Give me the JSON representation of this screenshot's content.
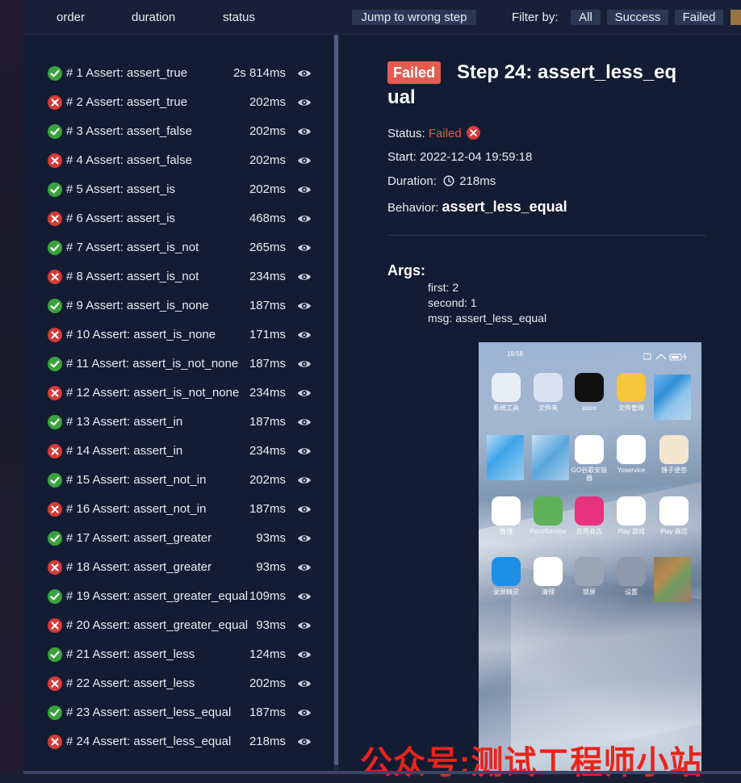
{
  "header": {
    "order": "order",
    "duration": "duration",
    "status": "status",
    "jump_button": "Jump to wrong step",
    "filter_label": "Filter by:",
    "filter_all": "All",
    "filter_success": "Success",
    "filter_failed": "Failed"
  },
  "steps": [
    {
      "name": "# 1 Assert: assert_true",
      "duration": "2s 814ms",
      "status": "success"
    },
    {
      "name": "# 2 Assert: assert_true",
      "duration": "202ms",
      "status": "failed"
    },
    {
      "name": "# 3 Assert: assert_false",
      "duration": "202ms",
      "status": "success"
    },
    {
      "name": "# 4 Assert: assert_false",
      "duration": "202ms",
      "status": "failed"
    },
    {
      "name": "# 5 Assert: assert_is",
      "duration": "202ms",
      "status": "success"
    },
    {
      "name": "# 6 Assert: assert_is",
      "duration": "468ms",
      "status": "failed"
    },
    {
      "name": "# 7 Assert: assert_is_not",
      "duration": "265ms",
      "status": "success"
    },
    {
      "name": "# 8 Assert: assert_is_not",
      "duration": "234ms",
      "status": "failed"
    },
    {
      "name": "# 9 Assert: assert_is_none",
      "duration": "187ms",
      "status": "success"
    },
    {
      "name": "# 10 Assert: assert_is_none",
      "duration": "171ms",
      "status": "failed"
    },
    {
      "name": "# 11 Assert: assert_is_not_none",
      "duration": "187ms",
      "status": "success"
    },
    {
      "name": "# 12 Assert: assert_is_not_none",
      "duration": "234ms",
      "status": "failed"
    },
    {
      "name": "# 13 Assert: assert_in",
      "duration": "187ms",
      "status": "success"
    },
    {
      "name": "# 14 Assert: assert_in",
      "duration": "234ms",
      "status": "failed"
    },
    {
      "name": "# 15 Assert: assert_not_in",
      "duration": "202ms",
      "status": "success"
    },
    {
      "name": "# 16 Assert: assert_not_in",
      "duration": "187ms",
      "status": "failed"
    },
    {
      "name": "# 17 Assert: assert_greater",
      "duration": "93ms",
      "status": "success"
    },
    {
      "name": "# 18 Assert: assert_greater",
      "duration": "93ms",
      "status": "failed"
    },
    {
      "name": "# 19 Assert: assert_greater_equal",
      "duration": "109ms",
      "status": "success"
    },
    {
      "name": "# 20 Assert: assert_greater_equal",
      "duration": "93ms",
      "status": "failed"
    },
    {
      "name": "# 21 Assert: assert_less",
      "duration": "124ms",
      "status": "success"
    },
    {
      "name": "# 22 Assert: assert_less",
      "duration": "202ms",
      "status": "failed"
    },
    {
      "name": "# 23 Assert: assert_less_equal",
      "duration": "187ms",
      "status": "success"
    },
    {
      "name": "# 24 Assert: assert_less_equal",
      "duration": "218ms",
      "status": "failed"
    }
  ],
  "detail": {
    "badge": "Failed",
    "title": "Step 24: assert_less_equal",
    "status_label": "Status:",
    "status_value": "Failed",
    "start_label": "Start:",
    "start_value": "2022-12-04 19:59:18",
    "duration_label": "Duration:",
    "duration_value": "218ms",
    "behavior_label": "Behavior:",
    "behavior_value": "assert_less_equal",
    "args_heading": "Args:",
    "args": [
      "first: 2",
      "second: 1",
      "msg: assert_less_equal"
    ]
  },
  "phone": {
    "status_time": "19:58",
    "apps": [
      {
        "label": "系统工具",
        "color": "#e9eef6"
      },
      {
        "label": "文件夹",
        "color": "#d9e2f1"
      },
      {
        "label": "poco",
        "color": "#111111"
      },
      {
        "label": "文件管理",
        "color": "#f5c53a"
      },
      {
        "label": "GO谷歌安装器",
        "color": "#ffffff"
      },
      {
        "label": "Yoservice",
        "color": "#ffffff"
      },
      {
        "label": "锤子便签",
        "color": "#f2e6cf"
      },
      {
        "label": "微博",
        "color": "#ffffff"
      },
      {
        "label": "PocoService",
        "color": "#5fb25a"
      },
      {
        "label": "应用商店",
        "color": "#e8317f"
      },
      {
        "label": "Play 游戏",
        "color": "#ffffff"
      },
      {
        "label": "Play 商店",
        "color": "#ffffff"
      },
      {
        "label": "录屏精灵",
        "color": "#1f8fe6"
      },
      {
        "label": "清理",
        "color": "#ffffff"
      },
      {
        "label": "锁屏",
        "color": "#9aa6b6"
      },
      {
        "label": "设置",
        "color": "#8e9aab"
      }
    ]
  },
  "watermark": "公众号:测试工程师小站"
}
